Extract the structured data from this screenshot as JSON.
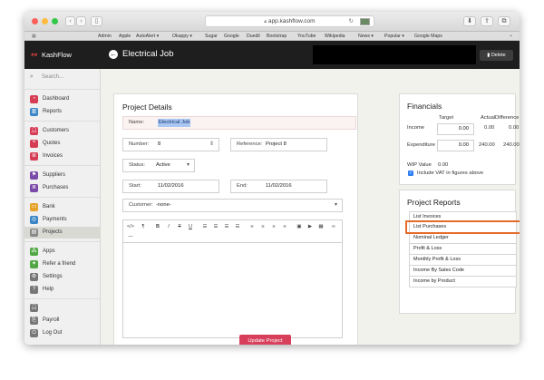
{
  "browser": {
    "url": "app.kashflow.com",
    "favorites": [
      "Admin",
      "Apple",
      "AutoAlert ▾",
      "Okappy ▾",
      "Sugar",
      "Google",
      "Duedil",
      "Bootstrap",
      "YouTube",
      "Wikipedia",
      "News ▾",
      "Popular ▾",
      "Google Maps"
    ]
  },
  "header": {
    "brand": "KashFlow",
    "title": "Electrical Job",
    "delete_label": "Delete"
  },
  "sidebar": {
    "search_placeholder": "Search...",
    "items": [
      {
        "label": "Dashboard",
        "icon": "dashboard-icon",
        "color": "#d63d55"
      },
      {
        "label": "Reports",
        "icon": "reports-icon",
        "color": "#3b86c6"
      },
      {
        "label": "Customers",
        "icon": "customers-icon",
        "color": "#d63d55"
      },
      {
        "label": "Quotes",
        "icon": "quotes-icon",
        "color": "#d63d55"
      },
      {
        "label": "Invoices",
        "icon": "invoices-icon",
        "color": "#d63d55"
      },
      {
        "label": "Suppliers",
        "icon": "suppliers-icon",
        "color": "#7a4aa8"
      },
      {
        "label": "Purchases",
        "icon": "purchases-icon",
        "color": "#7a4aa8"
      },
      {
        "label": "Bank",
        "icon": "bank-icon",
        "color": "#e5a32a"
      },
      {
        "label": "Payments",
        "icon": "payments-icon",
        "color": "#3b86c6"
      },
      {
        "label": "Projects",
        "icon": "projects-icon",
        "color": "#888888"
      },
      {
        "label": "Apps",
        "icon": "apps-icon",
        "color": "#52a845"
      },
      {
        "label": "Refer a friend",
        "icon": "refer-icon",
        "color": "#52a845"
      },
      {
        "label": "Settings",
        "icon": "settings-icon",
        "color": "#777777"
      },
      {
        "label": "Help",
        "icon": "help-icon",
        "color": "#777777"
      },
      {
        "label": "Payroll",
        "icon": "payroll-icon",
        "color": "#777777"
      },
      {
        "label": "Log Out",
        "icon": "logout-icon",
        "color": "#777777"
      }
    ]
  },
  "project": {
    "title": "Project Details",
    "name_label": "Name:",
    "name_value": "Electrical Job",
    "number_label": "Number:",
    "number_value": "8",
    "reference_label": "Reference:",
    "reference_value": "Project 8",
    "status_label": "Status:",
    "status_value": "Active",
    "start_label": "Start:",
    "start_value": "11/02/2016",
    "end_label": "End:",
    "end_value": "11/02/2016",
    "customer_label": "Customer:",
    "customer_value": "-none-",
    "update_label": "Update Project"
  },
  "financials": {
    "title": "Financials",
    "col_target": "Target",
    "col_actual": "Actual",
    "col_difference": "Difference",
    "income_label": "Income",
    "income_target": "0.00",
    "income_actual": "0.00",
    "income_difference": "0.00",
    "expenditure_label": "Expenditure",
    "expenditure_target": "0.00",
    "expenditure_actual": "240.00",
    "expenditure_difference": "240.00",
    "wip_label": "WIP Value",
    "wip_value": "0.00",
    "vat_label": "Include VAT in figures above"
  },
  "reports": {
    "title": "Project Reports",
    "items": [
      "List Invoices",
      "List Purchases",
      "Nominal Ledger",
      "Profit & Loss",
      "Monthly Profit & Loss",
      "Income By Sales Code",
      "Income by Product"
    ],
    "highlighted": "List Purchases"
  }
}
